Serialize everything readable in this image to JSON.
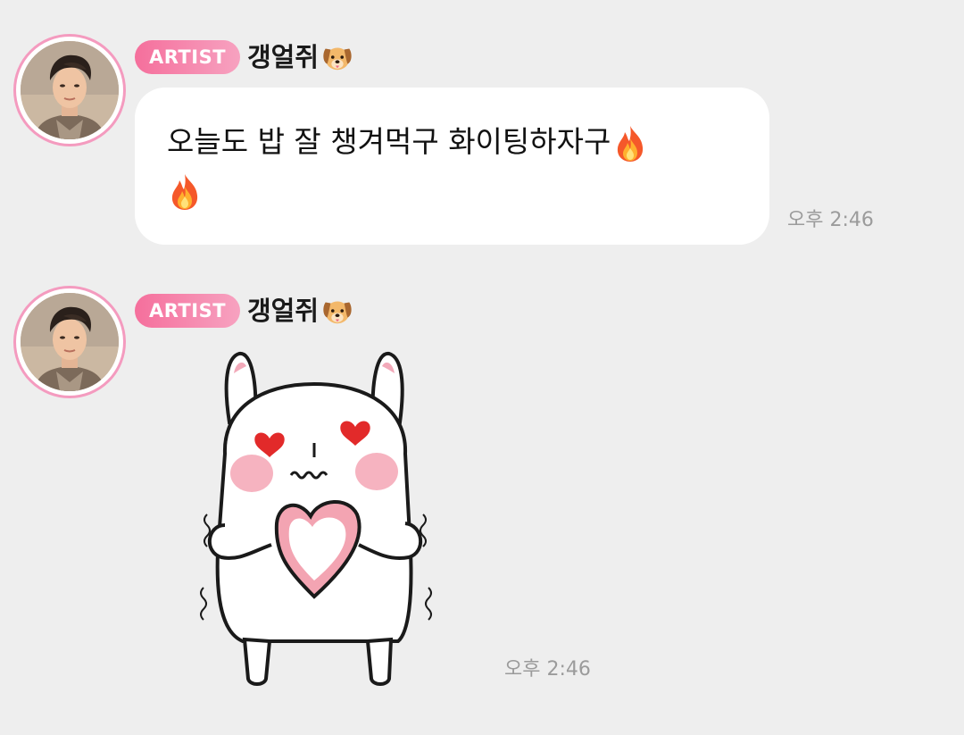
{
  "messages": [
    {
      "badge": "ARTIST",
      "sender_name": "갱얼쥐",
      "sender_emoji": "dog-face-emoji",
      "text": "오늘도 밥 잘 챙겨먹구 화이팅하자구",
      "text_emojis": [
        "fire-emoji",
        "fire-emoji"
      ],
      "time": "오후 2:46"
    },
    {
      "badge": "ARTIST",
      "sender_name": "갱얼쥐",
      "sender_emoji": "dog-face-emoji",
      "sticker": "white-bunny-holding-heart-sticker",
      "time": "오후 2:46"
    }
  ],
  "colors": {
    "background": "#eeeeee",
    "badge_start": "#f56f9c",
    "badge_end": "#f7a2c0",
    "avatar_ring": "#f49bbf",
    "time_text": "#9b9b9b"
  }
}
